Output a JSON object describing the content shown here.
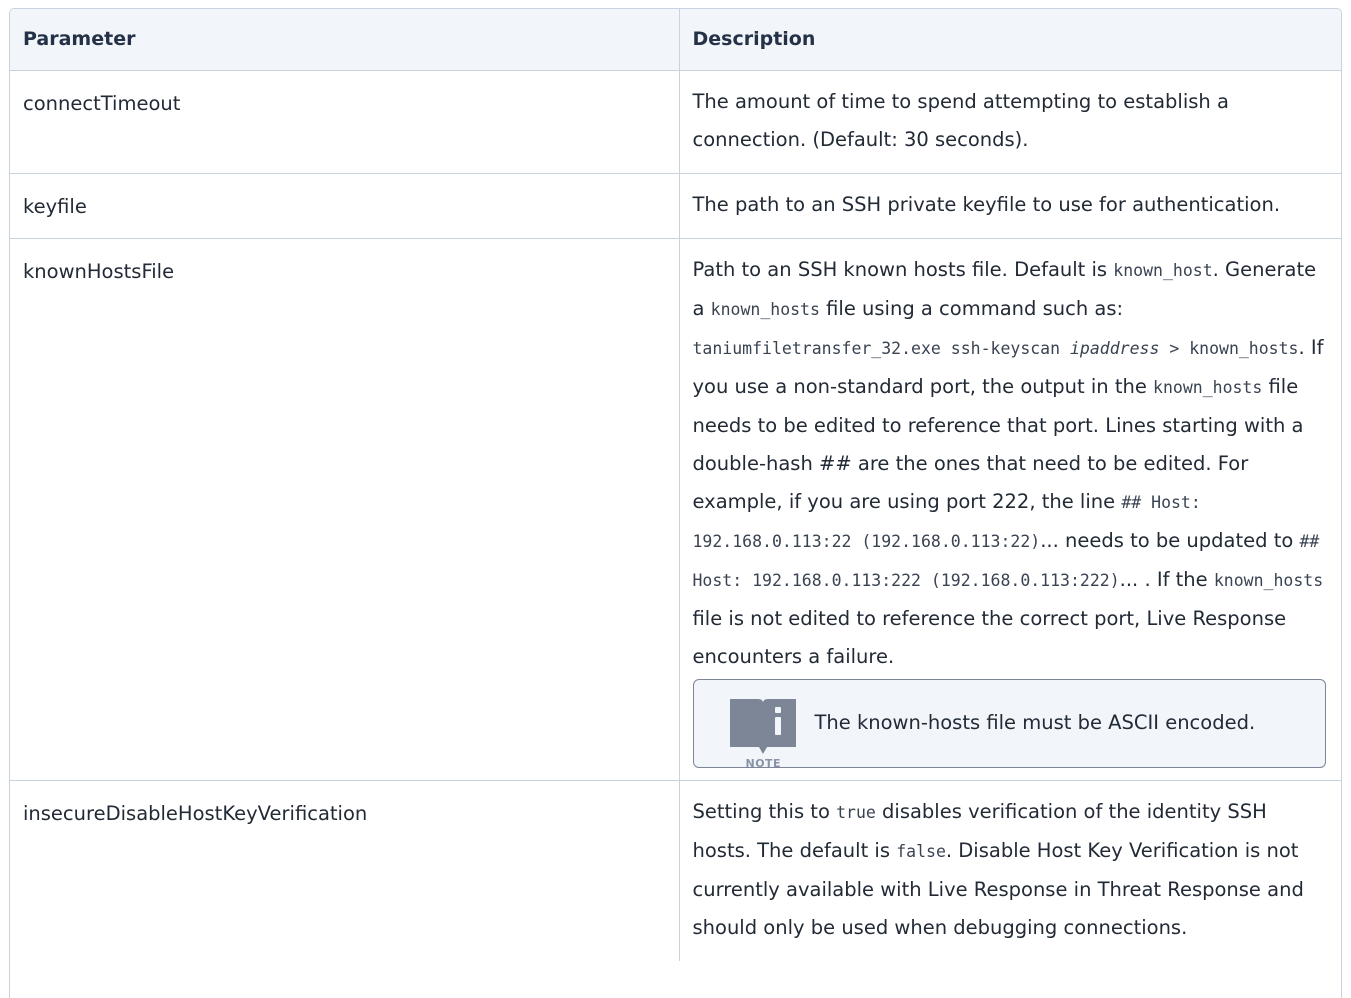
{
  "table": {
    "headers": [
      "Parameter",
      "Description"
    ],
    "rows": [
      {
        "param": "connectTimeout",
        "desc": "The amount of time to spend attempting to establish a connection. (Default: 30 seconds)."
      },
      {
        "param": "keyfile",
        "desc": "The path to an SSH private keyfile to use for authentication."
      },
      {
        "param": "knownHostsFile",
        "desc_parts": {
          "t1": "Path to an SSH known hosts file. Default is ",
          "c1": "known_host",
          "t2": ". Generate a ",
          "c2": "known_hosts",
          "t3": " file using a command such as: ",
          "c3": "taniumfiletransfer_32.exe ssh-keyscan ",
          "c3_em": "ipaddress",
          "c3_end": " > known_hosts",
          "t4": ". If you use a non-standard port, the output in the ",
          "c4": "known_hosts",
          "t5": " file needs to be edited to reference that port. Lines starting with a double-hash ## are the ones that need to be edited. For example, if you are using port 222, the line ",
          "c5": "## Host: 192.168.0.113:22 (192.168.0.113:22)",
          "t6": "... needs to be updated to ",
          "c6": "## Host: 192.168.0.113:222 (192.168.0.113:222)",
          "t7": "... . If the ",
          "c7": "known_hosts",
          "t8": " file is not edited to reference the correct port, Live Response encounters a failure."
        },
        "note": {
          "label": "NOTE",
          "text": "The known-hosts file must be ASCII encoded.",
          "icon": "book-info-icon"
        }
      },
      {
        "param": "insecureDisableHostKeyVerification",
        "desc_parts": {
          "t1": "Setting this to ",
          "c1": "true",
          "t2": " disables verification of the identity SSH hosts. The default is ",
          "c2": "false",
          "t3": ". Disable Host Key Verification is not currently available with Live Response in Threat Response and should only be used when debugging connections."
        }
      }
    ]
  },
  "colors": {
    "header_bg": "#f2f6fa",
    "border": "#c9d3e0",
    "note_border": "#7d8697",
    "icon": "#7d8697"
  }
}
